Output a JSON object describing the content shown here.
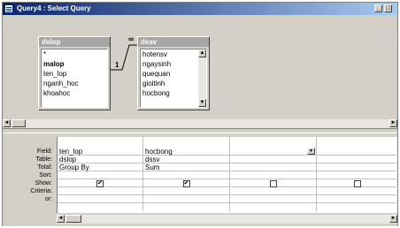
{
  "window": {
    "title": "Query4 : Select Query"
  },
  "tables": [
    {
      "name": "dslop",
      "fields": [
        "*",
        "malop",
        "ten_lop",
        "nganh_hoc",
        "khoahoc"
      ]
    },
    {
      "name": "dssv",
      "fields": [
        "hotensv",
        "ngaysinh",
        "quequan",
        "gioitinh",
        "hocbong"
      ]
    }
  ],
  "join": {
    "left_label": "1",
    "right_label": "∞"
  },
  "grid": {
    "row_labels": [
      "Field:",
      "Table:",
      "Total:",
      "Sort:",
      "Show:",
      "Criteria:",
      "or:"
    ],
    "columns": [
      {
        "field": "ten_lop",
        "table": "dslop",
        "total": "Group By",
        "sort": "",
        "show": true
      },
      {
        "field": "hocbong",
        "table": "dssv",
        "total": "Sum",
        "sort": "",
        "show": true
      },
      {
        "field": "",
        "table": "",
        "total": "",
        "sort": "",
        "show": false
      },
      {
        "field": "",
        "table": "",
        "total": "",
        "sort": "",
        "show": false
      }
    ]
  },
  "icons": {
    "check": "✔",
    "arrow_up": "▲",
    "arrow_down": "▼",
    "arrow_left": "◄",
    "arrow_right": "►"
  }
}
